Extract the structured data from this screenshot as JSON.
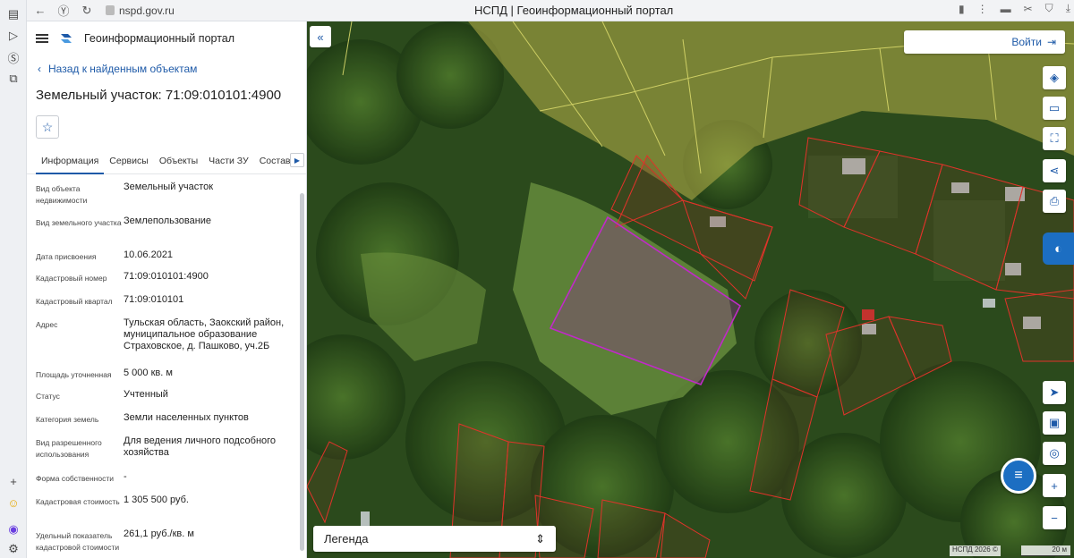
{
  "browser": {
    "url": "nspd.gov.ru",
    "tab_title": "НСПД | Геоинформационный портал"
  },
  "panel": {
    "portal_title": "Геоинформационный портал",
    "back_link": "Назад к найденным объектам",
    "object_title": "Земельный участок: 71:09:010101:4900",
    "tabs": [
      "Информация",
      "Сервисы",
      "Объекты",
      "Части ЗУ",
      "Состав"
    ],
    "fields": [
      {
        "label": "Вид объекта недвижимости",
        "value": "Земельный участок"
      },
      {
        "label": "Вид земельного участка",
        "value": "Землепользование"
      },
      {
        "label": "Дата присвоения",
        "value": "10.06.2021"
      },
      {
        "label": "Кадастровый номер",
        "value": "71:09:010101:4900"
      },
      {
        "label": "Кадастровый квартал",
        "value": "71:09:010101"
      },
      {
        "label": "Адрес",
        "value": "Тульская область, Заокский район, муниципальное образование Страховское, д. Пашково, уч.2Б"
      },
      {
        "label": "Площадь уточненная",
        "value": "5 000 кв. м"
      },
      {
        "label": "Статус",
        "value": "Учтенный"
      },
      {
        "label": "Категория земель",
        "value": "Земли населенных пунктов"
      },
      {
        "label": "Вид разрешенного использования",
        "value": "Для ведения личного подсобного хозяйства"
      },
      {
        "label": "Форма собственности",
        "value": "-"
      },
      {
        "label": "Кадастровая стоимость",
        "value": "1 305 500 руб."
      },
      {
        "label": "Удельный показатель кадастровой стоимости",
        "value": "261,1 руб./кв. м"
      }
    ]
  },
  "map": {
    "login_label": "Войти",
    "legend_label": "Легенда",
    "copyright": "НСПД 2026 ©",
    "scale_label": "20 м",
    "colors": {
      "selected_parcel": "#c02ac8",
      "parcel_outline": "#e0332a",
      "zone_outline": "#d8d86a",
      "accent": "#1e5aa8"
    },
    "tool_icons": [
      "layers-icon",
      "ruler-icon",
      "select-area-icon",
      "share-icon",
      "print-icon",
      "locate-icon",
      "basemap-icon",
      "geolocation-icon",
      "zoom-in-icon",
      "zoom-out-icon"
    ]
  }
}
